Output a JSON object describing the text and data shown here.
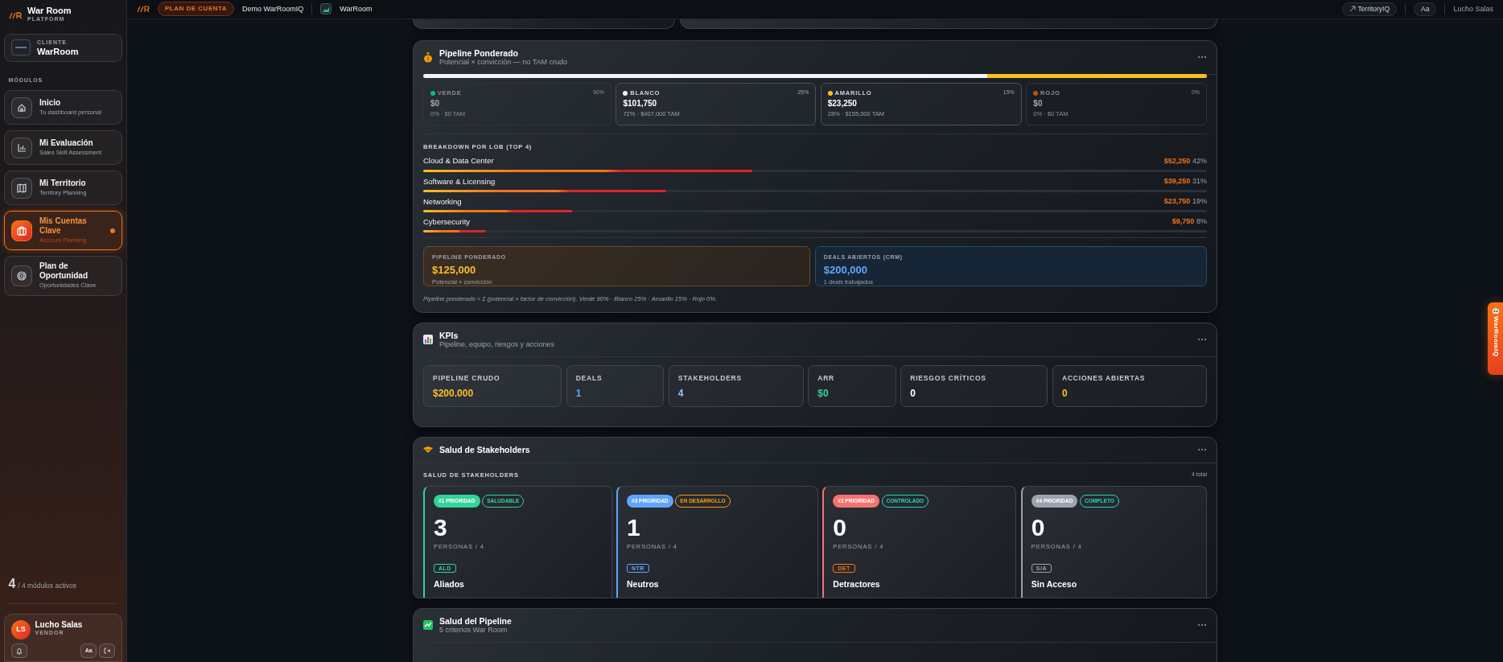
{
  "sidebar": {
    "brand": {
      "title": "War Room",
      "subtitle": "PLATFORM"
    },
    "client": {
      "label": "CLIENTE",
      "name": "WarRoom"
    },
    "section_label": "MÓDULOS",
    "items": [
      {
        "title": "Inicio",
        "subtitle": "Tu dashboard personal",
        "selected": false
      },
      {
        "title": "Mi Evaluación",
        "subtitle": "Sales Skill Assessment",
        "selected": false
      },
      {
        "title": "Mi Territorio",
        "subtitle": "Territory Planning",
        "selected": false
      },
      {
        "title": "Mis Cuentas Clave",
        "subtitle": "Account Planning",
        "selected": true
      },
      {
        "title": "Plan de Oportunidad",
        "subtitle": "Oportunidades Clave",
        "selected": false
      }
    ],
    "modules_count": "4",
    "modules_label": "/ 4 módulos activos",
    "user": {
      "initials": "LS",
      "name": "Lucho Salas",
      "role": "VENDOR",
      "font_button": "Aa"
    }
  },
  "topbar": {
    "plan_badge": "PLAN DE CUENTA",
    "account": "Demo WarRoomIQ",
    "client": "WarRoom",
    "territory_link": "TerritoryIQ",
    "font_button": "Aa",
    "user": "Lucho Salas"
  },
  "pipeline": {
    "title": "Pipeline Ponderado",
    "subtitle": "Potencial × convicción — no TAM crudo",
    "segments": [
      {
        "label": "VERDE",
        "factor": "90%",
        "amount": "$0",
        "detail": "0% · $0 TAM",
        "color": "#10b981",
        "level": 0,
        "active": false
      },
      {
        "label": "BLANCO",
        "factor": "25%",
        "amount": "$101,750",
        "detail": "72% · $407,000 TAM",
        "color": "#f1f5f9",
        "level": 0.72,
        "active": true
      },
      {
        "label": "AMARILLO",
        "factor": "15%",
        "amount": "$23,250",
        "detail": "28% · $155,000 TAM",
        "color": "#fbbf24",
        "level": 0.28,
        "active": true
      },
      {
        "label": "ROJO",
        "factor": "0%",
        "amount": "$0",
        "detail": "0% · $0 TAM",
        "color": "#b45309",
        "level": 0,
        "active": false
      }
    ],
    "breakdown_title": "BREAKDOWN POR LOB (TOP 4)",
    "lobs": [
      {
        "name": "Cloud & Data Center",
        "amount": "$52,250",
        "percent": "42%",
        "level": 0.42
      },
      {
        "name": "Software & Licensing",
        "amount": "$39,250",
        "percent": "31%",
        "level": 0.31
      },
      {
        "name": "Networking",
        "amount": "$23,750",
        "percent": "19%",
        "level": 0.19
      },
      {
        "name": "Cybersecurity",
        "amount": "$9,750",
        "percent": "8%",
        "level": 0.08
      }
    ],
    "summary": [
      {
        "kind": "weighted",
        "label": "PIPELINE PONDERADO",
        "value": "$125,000",
        "note": "Potencial × convicción"
      },
      {
        "kind": "crm",
        "label": "DEALS ABIERTOS (CRM)",
        "value": "$200,000",
        "note": "1 deals trabajados"
      }
    ],
    "footnote": "Pipeline ponderado = Σ (potencial × factor de convicción). Verde 90% · Blanco 25% · Amarillo 15% · Rojo 0%."
  },
  "kpis": {
    "title": "KPIs",
    "subtitle": "Pipeline, equipo, riesgos y acciones",
    "tiles": [
      {
        "label": "PIPELINE CRUDO",
        "value": "$200.000",
        "color": "#fbbf24"
      },
      {
        "label": "DEALS",
        "value": "1",
        "color": "#60a5fa"
      },
      {
        "label": "STAKEHOLDERS",
        "value": "4",
        "color": "#93c5fd"
      },
      {
        "label": "ARR",
        "value": "$0",
        "color": "#34d399"
      },
      {
        "label": "RIESGOS CRÍTICOS",
        "value": "0",
        "color": "#ffffff"
      },
      {
        "label": "ACCIONES ABIERTAS",
        "value": "0",
        "color": "#fbbf24"
      }
    ]
  },
  "stakeholders": {
    "title": "Salud de Stakeholders",
    "section_label": "SALUD DE STAKEHOLDERS",
    "total": "4 total",
    "groups": [
      {
        "priority": "#1 PRIORIDAD",
        "color": "#34d399",
        "status": {
          "text": "SALUDABLE",
          "color": "#34d399"
        },
        "count": "3",
        "persons": "PERSONAS / 4",
        "code": {
          "text": "ALD",
          "color": "#34d399"
        },
        "name": "Aliados"
      },
      {
        "priority": "#3 PRIORIDAD",
        "color": "#60a5fa",
        "status": {
          "text": "EN DESARROLLO",
          "color": "#f59e0b"
        },
        "count": "1",
        "persons": "PERSONAS / 4",
        "code": {
          "text": "NTR",
          "color": "#60a5fa"
        },
        "name": "Neutros"
      },
      {
        "priority": "#2 PRIORIDAD",
        "color": "#f87171",
        "status": {
          "text": "CONTROLADO",
          "color": "#2dd4bf"
        },
        "count": "0",
        "persons": "PERSONAS / 4",
        "code": {
          "text": "DET",
          "color": "#f97316"
        },
        "name": "Detractores"
      },
      {
        "priority": "#4 PRIORIDAD",
        "color": "#9ca3af",
        "status": {
          "text": "COMPLETO",
          "color": "#2dd4bf"
        },
        "count": "0",
        "persons": "PERSONAS / 4",
        "code": {
          "text": "S/A",
          "color": "#9ca3af"
        },
        "name": "Sin Acceso"
      }
    ]
  },
  "pipeline_health": {
    "title": "Salud del Pipeline",
    "subtitle": "5 criterios War Room"
  },
  "assistant_tab": {
    "label": "WarRoomIQ"
  }
}
